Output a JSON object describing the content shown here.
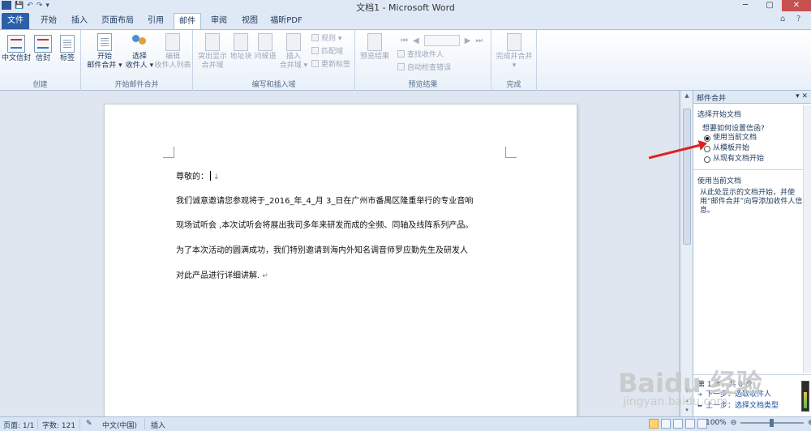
{
  "window": {
    "title": "文档1 - Microsoft Word",
    "qat_items": [
      "W",
      "💾",
      "↶",
      "↷",
      "▾"
    ]
  },
  "tabs": [
    {
      "label": "文件"
    },
    {
      "label": "开始"
    },
    {
      "label": "插入"
    },
    {
      "label": "页面布局"
    },
    {
      "label": "引用"
    },
    {
      "label": "邮件"
    },
    {
      "label": "审阅"
    },
    {
      "label": "视图"
    },
    {
      "label": "福昕PDF"
    }
  ],
  "ribbon": {
    "groups": {
      "create": "创建",
      "start_merge": "开始邮件合并",
      "write_insert": "编写和插入域",
      "preview": "预览结果",
      "finish": "完成"
    },
    "buttons": {
      "cn_envelope": "中文信封",
      "envelope": "信封",
      "label": "标签",
      "start_merge_1": "开始",
      "start_merge_2": "邮件合并 ▾",
      "select_recipients_1": "选择",
      "select_recipients_2": "收件人 ▾",
      "edit_recipients_1": "编辑",
      "edit_recipients_2": "收件人列表",
      "highlight_fields_1": "突出显示",
      "highlight_fields_2": "合并域",
      "address_block": "地址块",
      "greeting": "问候语",
      "insert_field_1": "插入",
      "insert_field_2": "合并域 ▾",
      "rules": "规则 ▾",
      "match_fields": "匹配域",
      "update_labels": "更新标签",
      "preview_results": "预览结果",
      "find_recipient": "查找收件人",
      "auto_check": "自动检查错误",
      "finish_merge_1": "完成并合并",
      "finish_merge_2": "▾"
    }
  },
  "document": {
    "lines": [
      "尊敬的：",
      "我们诚意邀请您参观将于_2016_年_4_月 3_日在广州市番禺区隆重举行的专业音响",
      "现场试听会 ,本次试听会将展出我司多年来研发而成的全频、同轴及线阵系列产品。",
      "为了本次活动的圆满成功，我们特别邀请到海内外知名调音师罗应勤先生及研发人",
      "对此产品进行详细讲解."
    ],
    "para_mark_down": "↓",
    "para_mark": "↵"
  },
  "pane": {
    "title": "邮件合并",
    "controls": "▾  ✕",
    "section1_title": "选择开始文档",
    "question": "想要如何设置信函?",
    "options": [
      "使用当前文档",
      "从模板开始",
      "从现有文档开始"
    ],
    "section2_title": "使用当前文档",
    "section2_desc": "从此处显示的文档开始，并使用“邮件合并”向导添加收件人信息。",
    "step_label": "第 1 步，共 6 步",
    "next_link": "下一步：选取收件人",
    "prev_link": "上一步：选择文档类型"
  },
  "status": {
    "page": "页面: 1/1",
    "words": "字数: 121",
    "language": "中文(中国)",
    "mode": "插入",
    "zoom": "100%",
    "zoom_minus": "⊖",
    "zoom_plus": "⊕"
  },
  "watermark": {
    "brand": "Baidu 经验",
    "url": "jingyan.baidu.com"
  }
}
